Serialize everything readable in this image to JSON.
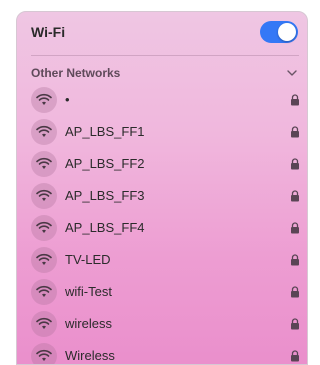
{
  "header": {
    "title": "Wi-Fi",
    "wifi_enabled": true,
    "toggle_color": "#3478f6"
  },
  "section": {
    "label": "Other Networks",
    "expand_icon": "chevron-down-icon"
  },
  "networks": [
    {
      "name": "•",
      "secured": true,
      "icon": "wifi-icon"
    },
    {
      "name": "AP_LBS_FF1",
      "secured": true,
      "icon": "wifi-icon"
    },
    {
      "name": "AP_LBS_FF2",
      "secured": true,
      "icon": "wifi-icon"
    },
    {
      "name": "AP_LBS_FF3",
      "secured": true,
      "icon": "wifi-icon"
    },
    {
      "name": "AP_LBS_FF4",
      "secured": true,
      "icon": "wifi-icon"
    },
    {
      "name": "TV-LED",
      "secured": true,
      "icon": "wifi-icon"
    },
    {
      "name": "wifi-Test",
      "secured": true,
      "icon": "wifi-icon"
    },
    {
      "name": "wireless",
      "secured": true,
      "icon": "wifi-icon"
    },
    {
      "name": "Wireless",
      "secured": true,
      "icon": "wifi-icon"
    }
  ]
}
